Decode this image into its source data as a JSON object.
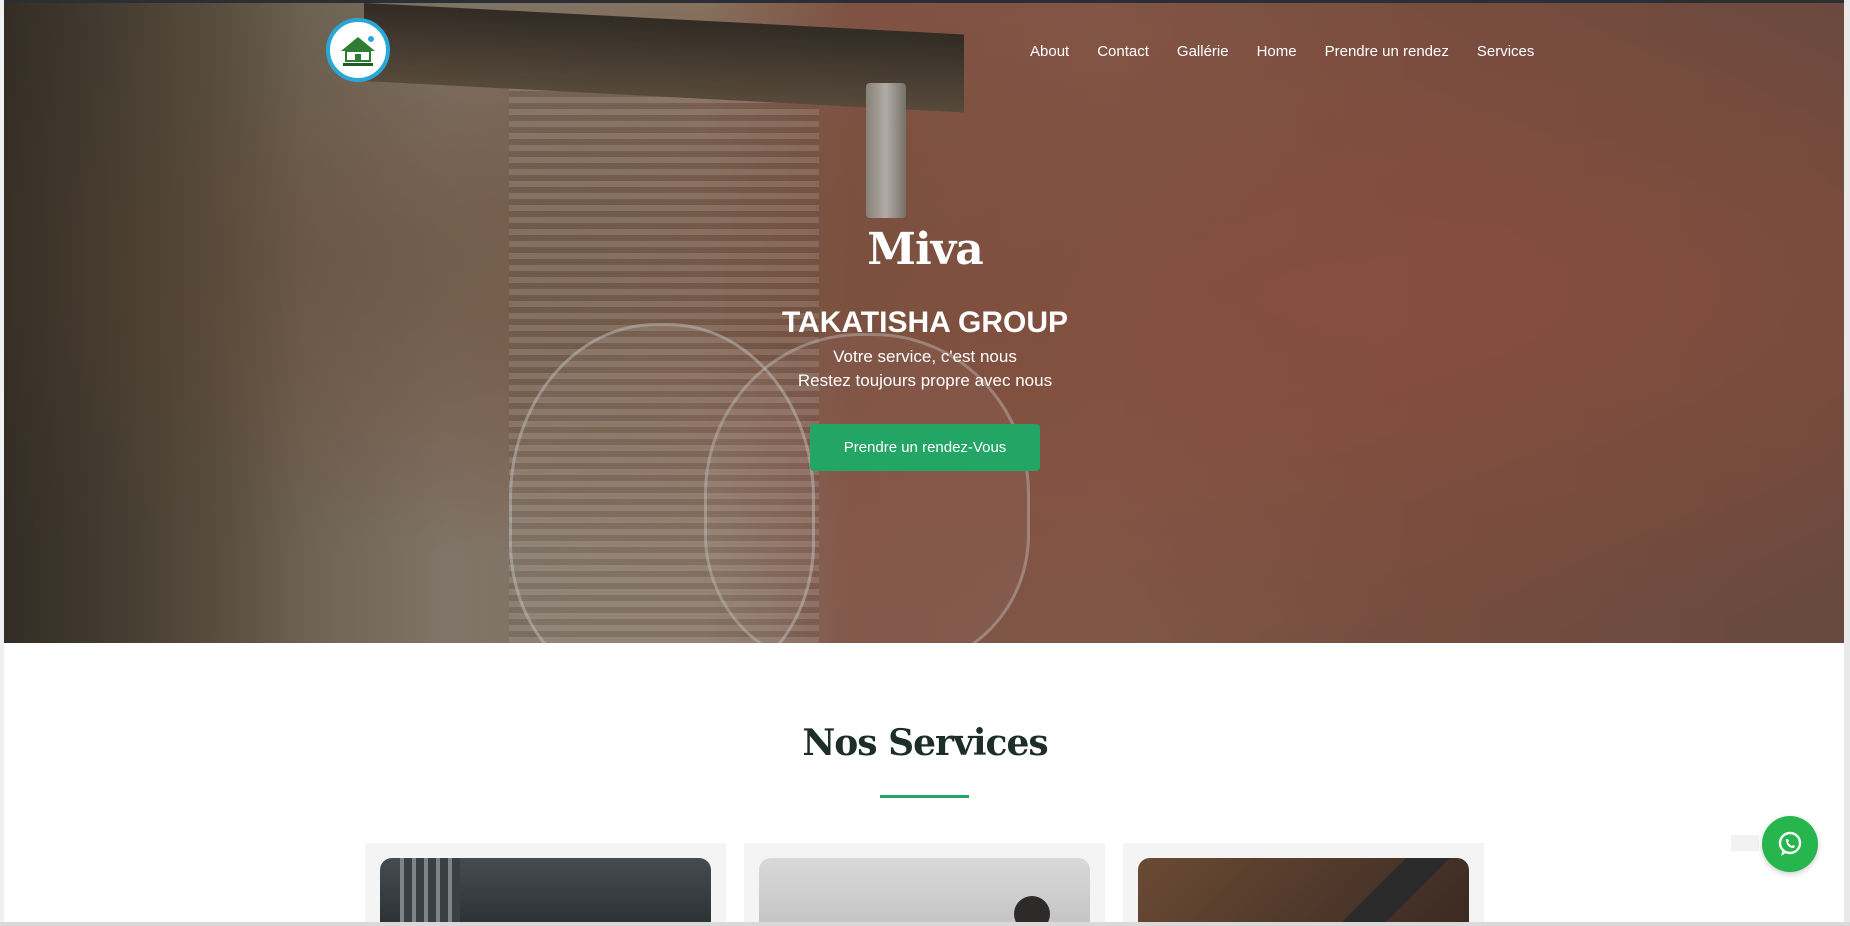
{
  "header": {
    "logo_name": "takatisha-group-logo",
    "nav": [
      {
        "label": "About"
      },
      {
        "label": "Contact"
      },
      {
        "label": "Gallérie"
      },
      {
        "label": "Home"
      },
      {
        "label": "Prendre un rendez"
      },
      {
        "label": "Services"
      }
    ]
  },
  "hero": {
    "brand": "Miva",
    "company": "TAKATISHA GROUP",
    "tagline_1": "Votre service, c'est nous",
    "tagline_2": "Restez toujours propre avec nous",
    "cta_label": "Prendre un rendez-Vous"
  },
  "services": {
    "title": "Nos Services"
  },
  "colors": {
    "accent": "#22a565",
    "whatsapp": "#27b64d",
    "logo_ring": "#29a8d8",
    "title_text": "#1d2d27"
  },
  "icons": {
    "whatsapp": "whatsapp-icon"
  }
}
